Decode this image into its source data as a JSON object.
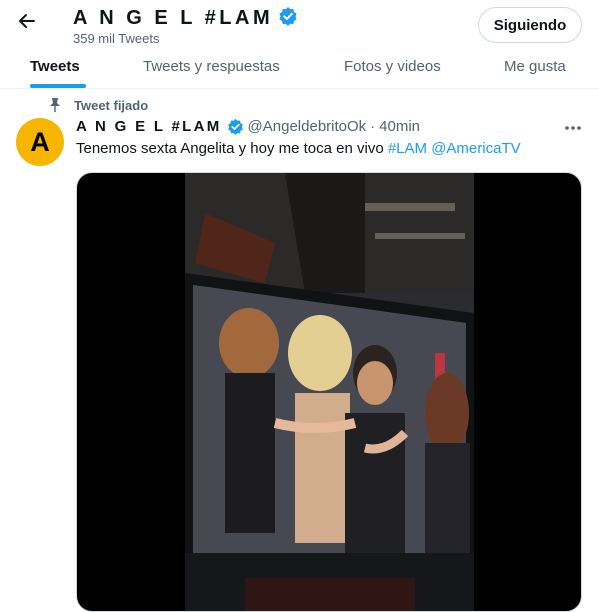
{
  "profile": {
    "display_name": "A N G E L #LAM",
    "tweet_count": "359 mil Tweets",
    "follow_label": "Siguiendo"
  },
  "tabs": [
    {
      "label": "Tweets",
      "active": true
    },
    {
      "label": "Tweets y respuestas",
      "active": false
    },
    {
      "label": "Fotos y videos",
      "active": false
    },
    {
      "label": "Me gusta",
      "active": false
    }
  ],
  "tweet": {
    "pinned_label": "Tweet fijado",
    "avatar_letter": "A",
    "author": "A N G E L #LAM",
    "handle": "@AngeldebritoOk",
    "separator": "·",
    "time": "40min",
    "text": "Tenemos sexta Angelita y hoy me toca en vivo ",
    "hashtag": "#LAM",
    "mention": "@AmericaTV"
  },
  "colors": {
    "accent": "#1d9bf0",
    "avatar_bg": "#f7b500",
    "secondary_text": "#536471"
  },
  "icons": [
    "back-arrow-icon",
    "verified-badge-icon",
    "pin-icon",
    "more-icon"
  ]
}
